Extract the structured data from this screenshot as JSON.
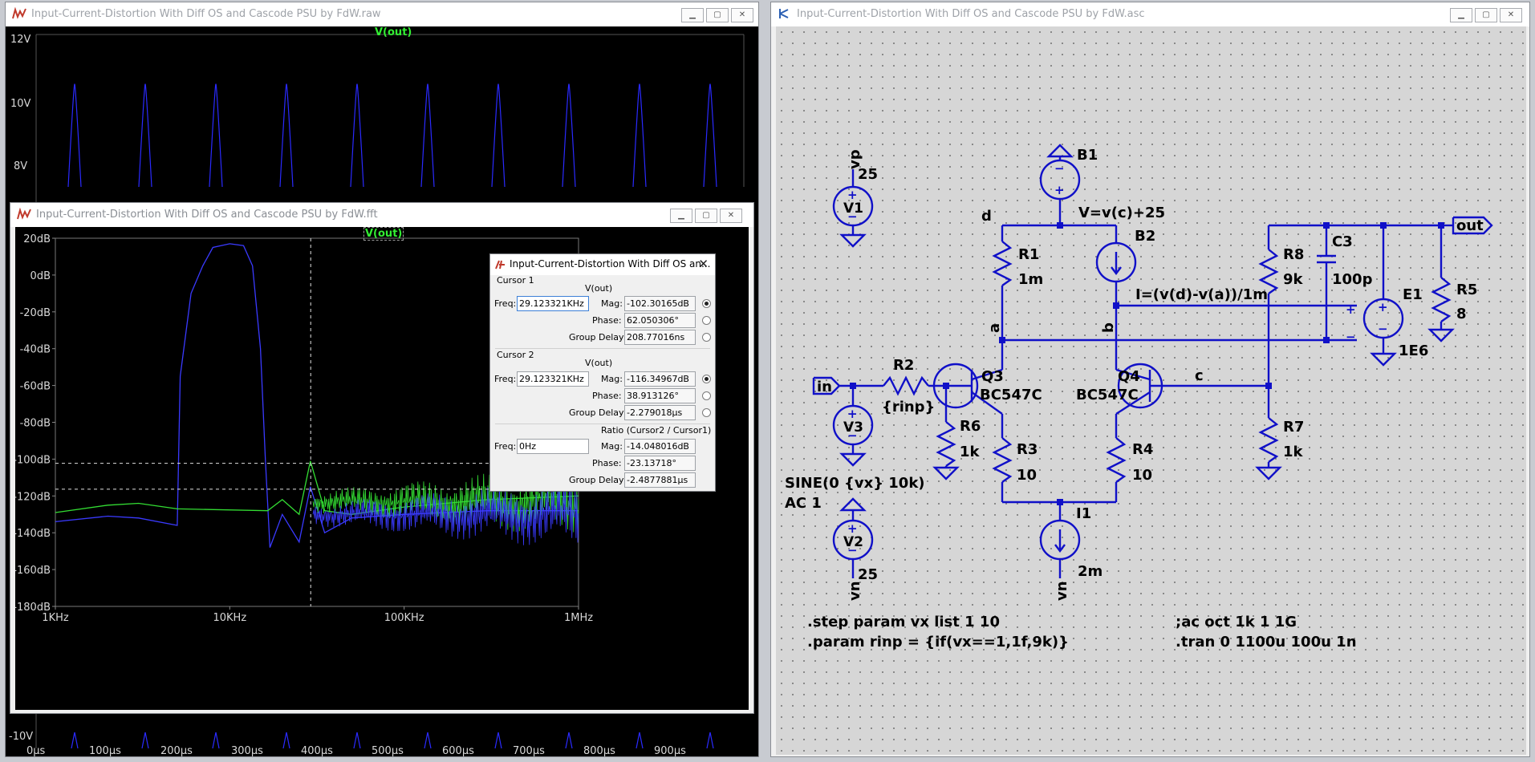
{
  "raw_window": {
    "title": "Input-Current-Distortion With Diff OS and Cascode PSU by FdW.raw",
    "trace_label": "V(out)",
    "y_labels": [
      "12V",
      "10V",
      "8V",
      "-10V"
    ],
    "x_labels": [
      "0µs",
      "100µs",
      "200µs",
      "300µs",
      "400µs",
      "500µs",
      "600µs",
      "700µs",
      "800µs",
      "900µs"
    ]
  },
  "fft_window": {
    "title": "Input-Current-Distortion With Diff OS and Cascode PSU by FdW.fft",
    "trace_label": "V(out)",
    "chart_data": {
      "type": "line",
      "xscale": "log",
      "xlim": [
        1000,
        1000000
      ],
      "ylim": [
        -180,
        20
      ],
      "x_ticks": [
        "1KHz",
        "10KHz",
        "100KHz",
        "1MHz"
      ],
      "y_ticks": [
        "20dB",
        "0dB",
        "-20dB",
        "-40dB",
        "-60dB",
        "-80dB",
        "-100dB",
        "-120dB",
        "-140dB",
        "-160dB",
        "-180dB"
      ],
      "cursor_freq": 29123,
      "cursor1_level": -102.3,
      "cursor2_level": -116.35,
      "series": [
        {
          "color": "#3a3aff",
          "points": [
            [
              1000,
              -134
            ],
            [
              2000,
              -131
            ],
            [
              3000,
              -132
            ],
            [
              5000,
              -136
            ],
            [
              5200,
              -55
            ],
            [
              6000,
              -10
            ],
            [
              7000,
              5
            ],
            [
              8000,
              15
            ],
            [
              10000,
              17
            ],
            [
              12000,
              16
            ],
            [
              13500,
              5
            ],
            [
              15000,
              -40
            ],
            [
              16000,
              -100
            ],
            [
              17000,
              -148
            ],
            [
              20000,
              -130
            ],
            [
              25000,
              -145
            ],
            [
              29000,
              -115
            ],
            [
              35000,
              -140
            ],
            [
              50000,
              -132
            ],
            [
              100000,
              -130
            ],
            [
              300000,
              -128
            ],
            [
              1000000,
              -128
            ]
          ]
        },
        {
          "color": "#33dd33",
          "points": [
            [
              1000,
              -129
            ],
            [
              2000,
              -125
            ],
            [
              3000,
              -124
            ],
            [
              5000,
              -127
            ],
            [
              16500,
              -128
            ],
            [
              20000,
              -122
            ],
            [
              25000,
              -130
            ],
            [
              29000,
              -101
            ],
            [
              35000,
              -128
            ],
            [
              50000,
              -130
            ],
            [
              100000,
              -126
            ],
            [
              300000,
              -122
            ],
            [
              1000000,
              -120
            ]
          ]
        }
      ]
    }
  },
  "cursor_dialog": {
    "title": "Input-Current-Distortion With Diff OS an...",
    "cursor1": {
      "heading": "Cursor 1",
      "trace": "V(out)",
      "freq_label": "Freq:",
      "freq": "29.123321KHz",
      "mag_label": "Mag:",
      "mag": "-102.30165dB",
      "phase_label": "Phase:",
      "phase": "62.050306°",
      "gd_label": "Group Delay:",
      "gd": "208.77016ns"
    },
    "cursor2": {
      "heading": "Cursor 2",
      "trace": "V(out)",
      "freq_label": "Freq:",
      "freq": "29.123321KHz",
      "mag_label": "Mag:",
      "mag": "-116.34967dB",
      "phase_label": "Phase:",
      "phase": "38.913126°",
      "gd_label": "Group Delay:",
      "gd": "-2.279018µs"
    },
    "ratio": {
      "heading": "Ratio (Cursor2 / Cursor1)",
      "freq_label": "Freq:",
      "freq": "0Hz",
      "mag_label": "Mag:",
      "mag": "-14.048016dB",
      "phase_label": "Phase:",
      "phase": "-23.13718°",
      "gd_label": "Group Delay:",
      "gd": "-2.4877881µs"
    }
  },
  "schematic_window": {
    "title": "Input-Current-Distortion With Diff OS and Cascode PSU by FdW.asc",
    "labels": {
      "vp": "vp",
      "v1_val": "25",
      "v1": "V1",
      "b1": "B1",
      "b1_expr": "V=v(c)+25",
      "b2": "B2",
      "d": "d",
      "r1": "R1",
      "r1_val": "1m",
      "a": "a",
      "b": "b",
      "c": "c",
      "r8": "R8",
      "r8_val": "9k",
      "c3": "C3",
      "c3_val": "100p",
      "out": "out",
      "b2_expr": "I=(v(d)-v(a))/1m",
      "e1": "E1",
      "e1_val": "1E6",
      "r5": "R5",
      "r5_val": "8",
      "in": "in",
      "r2": "R2",
      "r2_val": "{rinp}",
      "q3": "Q3",
      "q3_model": "BC547C",
      "q4": "Q4",
      "q4_model": "BC547C",
      "v3": "V3",
      "r6": "R6",
      "r6_val": "1k",
      "r3": "R3",
      "r3_val": "10",
      "r4": "R4",
      "r4_val": "10",
      "r7": "R7",
      "r7_val": "1k",
      "v3_sine": "SINE(0 {vx} 10k)",
      "v3_ac": "AC 1",
      "i1": "I1",
      "i1_val": "2m",
      "v2": "V2",
      "v2_val": "25",
      "vn": "vn",
      "step": ".step param vx list 1 10",
      "param": ".param rinp = {if(vx==1,1f,9k)}",
      "ac": ";ac oct 1k 1 1G",
      "tran": ".tran 0 1100u 100u 1n"
    }
  }
}
